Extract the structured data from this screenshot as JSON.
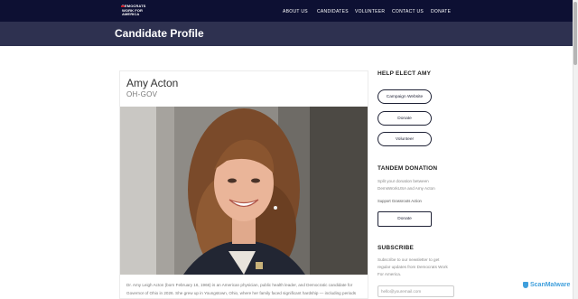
{
  "header": {
    "logo_text": [
      "DEMOCRATS",
      "WORK FOR",
      "AMERICA"
    ],
    "nav": [
      "ABOUT US",
      "CANDIDATES",
      "VOLUNTEER",
      "CONTACT US",
      "DONATE"
    ]
  },
  "page_title": "Candidate Profile",
  "candidate": {
    "name": "Amy Acton",
    "office": "OH-GOV",
    "bio": "Dr. Amy Leigh Acton (born February 16, 1966) is an American physician, public health leader, and Democratic candidate for Governor of Ohio in 2026. She grew up in Youngstown, Ohio, where her family faced significant hardship — including periods"
  },
  "sidebar": {
    "help_heading": "HELP ELECT AMY",
    "help_buttons": [
      "Campaign Website",
      "Donate",
      "Volunteer"
    ],
    "tandem_heading": "TANDEM DONATION",
    "tandem_text": [
      "Split your donation between",
      "DemsWorkUSA and Amy Acton"
    ],
    "tandem_note": "Support Grassroots Action",
    "tandem_button": "Donate",
    "subscribe_heading": "SUBSCRIBE",
    "subscribe_text": [
      "Subscribe to our newsletter to get",
      "regular updates from Democrats Work",
      "For America."
    ],
    "email_placeholder": "hello@youremail.com"
  },
  "watermark": "ScanMalware",
  "colors": {
    "nav_bg": "#0d1033",
    "title_band": "#2e3150",
    "button_border": "#1f2236",
    "watermark": "#1f8fd6"
  }
}
